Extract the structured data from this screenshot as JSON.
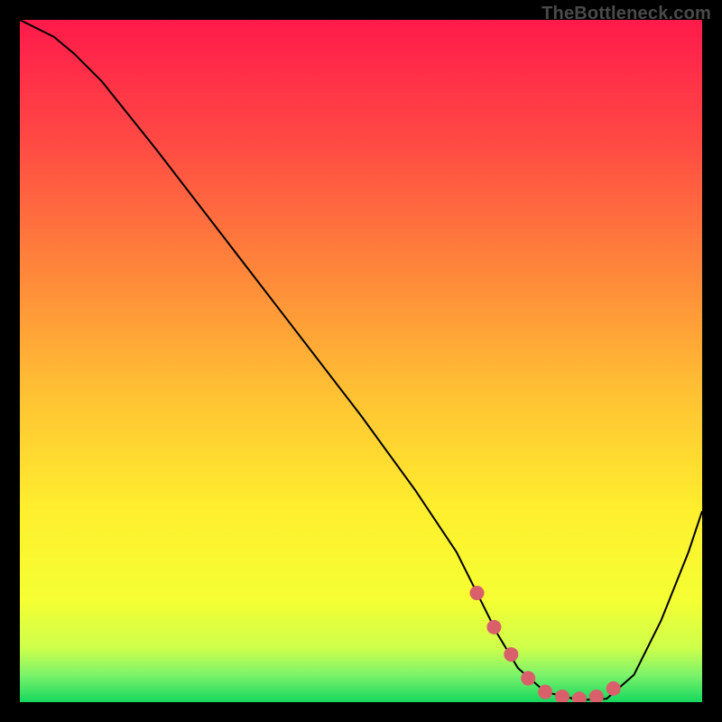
{
  "watermark": "TheBottleneck.com",
  "chart_data": {
    "type": "line",
    "title": "",
    "xlabel": "",
    "ylabel": "",
    "xlim": [
      0,
      100
    ],
    "ylim": [
      0,
      100
    ],
    "grid": false,
    "legend": false,
    "background_gradient": {
      "stops": [
        {
          "offset": 0.0,
          "color": "#ff1a4b"
        },
        {
          "offset": 0.18,
          "color": "#ff4a44"
        },
        {
          "offset": 0.38,
          "color": "#ff8a3a"
        },
        {
          "offset": 0.55,
          "color": "#ffc233"
        },
        {
          "offset": 0.72,
          "color": "#ffef2e"
        },
        {
          "offset": 0.85,
          "color": "#f5ff33"
        },
        {
          "offset": 0.92,
          "color": "#cfff4a"
        },
        {
          "offset": 0.96,
          "color": "#7cf36a"
        },
        {
          "offset": 1.0,
          "color": "#15d85e"
        }
      ]
    },
    "series": [
      {
        "name": "curve",
        "color": "#000000",
        "width": 2,
        "x": [
          0,
          2,
          5,
          8,
          12,
          20,
          30,
          40,
          50,
          58,
          64,
          67,
          70,
          73,
          77,
          82,
          86,
          90,
          94,
          98,
          100
        ],
        "y": [
          100,
          99,
          97.5,
          95,
          91,
          81,
          68,
          55,
          42,
          31,
          22,
          16,
          10,
          5,
          1.5,
          0.3,
          0.5,
          4,
          12,
          22,
          28
        ]
      },
      {
        "name": "highlight-dots",
        "color": "#d9606a",
        "marker_size": 8,
        "x": [
          67,
          69.5,
          72,
          74.5,
          77,
          79.5,
          82,
          84.5,
          87
        ],
        "y": [
          16,
          11,
          7,
          3.5,
          1.5,
          0.8,
          0.5,
          0.8,
          2
        ]
      }
    ]
  }
}
